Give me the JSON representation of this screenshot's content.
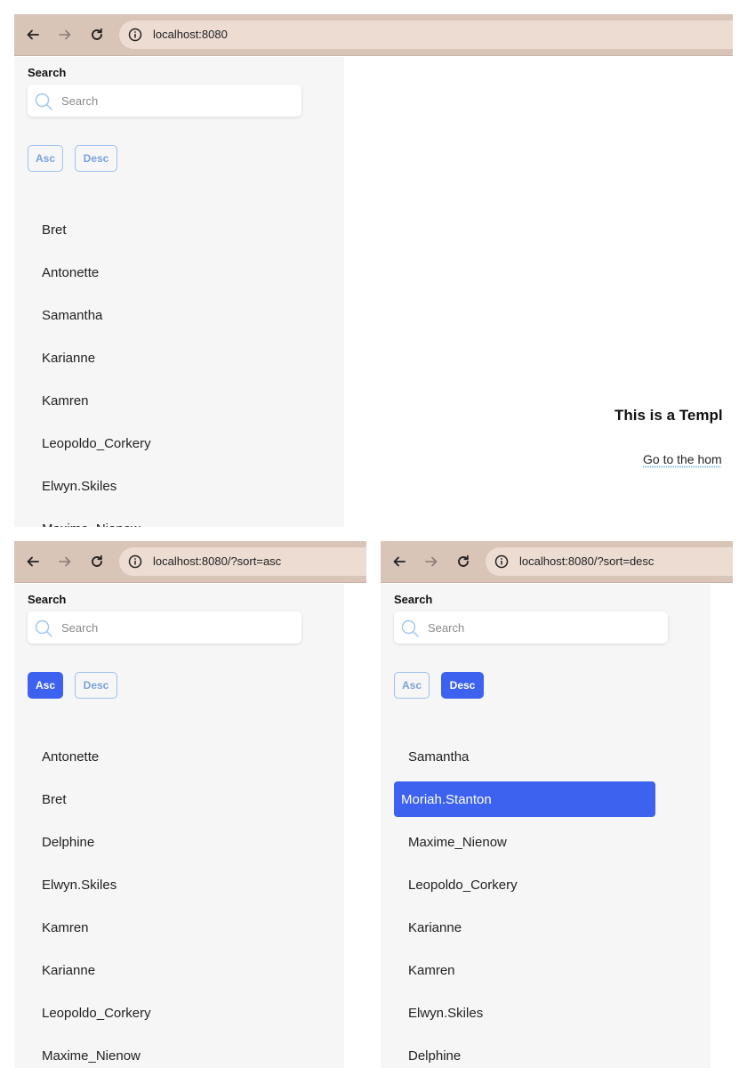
{
  "icons": {
    "back": "arrow-left-icon",
    "forward": "arrow-right-icon",
    "reload": "reload-icon",
    "info": "info-icon",
    "search": "search-icon"
  },
  "colors": {
    "browser_bar": "#d9c4b8",
    "url_pill": "#ecdcd2",
    "sidebar_bg": "#f6f6f6",
    "accent": "#3d62f0",
    "outline_button": "#9fc0ec"
  },
  "screens": [
    {
      "url": "localhost:8080",
      "search_label": "Search",
      "search_placeholder": "Search",
      "asc_label": "Asc",
      "desc_label": "Desc",
      "selected_sort": "none",
      "items": [
        "Bret",
        "Antonette",
        "Samantha",
        "Karianne",
        "Kamren",
        "Leopoldo_Corkery",
        "Elwyn.Skiles",
        "Maxime_Nienow"
      ],
      "main_title": "This is a Templ",
      "main_link": "Go to the hom"
    },
    {
      "url": "localhost:8080/?sort=asc",
      "search_label": "Search",
      "search_placeholder": "Search",
      "asc_label": "Asc",
      "desc_label": "Desc",
      "selected_sort": "asc",
      "items": [
        "Antonette",
        "Bret",
        "Delphine",
        "Elwyn.Skiles",
        "Kamren",
        "Karianne",
        "Leopoldo_Corkery",
        "Maxime_Nienow"
      ]
    },
    {
      "url": "localhost:8080/?sort=desc",
      "search_label": "Search",
      "search_placeholder": "Search",
      "asc_label": "Asc",
      "desc_label": "Desc",
      "selected_sort": "desc",
      "active_item": "Moriah.Stanton",
      "items": [
        "Samantha",
        "Moriah.Stanton",
        "Maxime_Nienow",
        "Leopoldo_Corkery",
        "Karianne",
        "Kamren",
        "Elwyn.Skiles",
        "Delphine"
      ]
    }
  ]
}
